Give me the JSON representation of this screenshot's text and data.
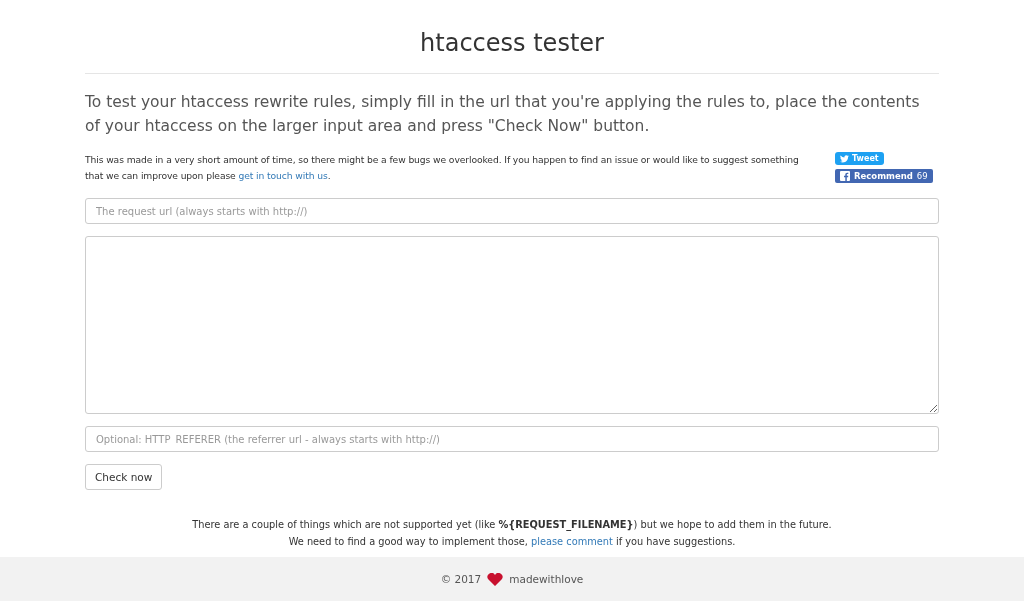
{
  "title": "htaccess tester",
  "intro": "To test your htaccess rewrite rules, simply fill in the url that you're applying the rules to, place the contents of your htaccess on the larger input area and press \"Check Now\" button.",
  "notice": {
    "text_before": "This was made in a very short amount of time, so there might be a few bugs we overlooked. If you happen to find an issue or would like to suggest something that we can improve upon please ",
    "link": "get in touch with us",
    "text_after": "."
  },
  "social": {
    "tweet": "Tweet",
    "recommend": "Recommend",
    "recommend_count": "69"
  },
  "url_field": {
    "placeholder": "The request url (always starts with http://)"
  },
  "referer_field": {
    "placeholder": "Optional: HTTP_REFERER (the referrer url - always starts with http://)"
  },
  "check_button": "Check now",
  "bottom_note": {
    "line_1": "There are a couple of things which are not supported yet (like **%{REQUEST_FILENAME}**) but we hope to add them in the future.",
    "line_2_before": "We need to find a good way to implement those, ",
    "line_2_link": "please comment",
    "line_2_after": " if you have suggestions."
  },
  "footer": {
    "copyright": "© 2017",
    "brand": "madewithlove"
  }
}
